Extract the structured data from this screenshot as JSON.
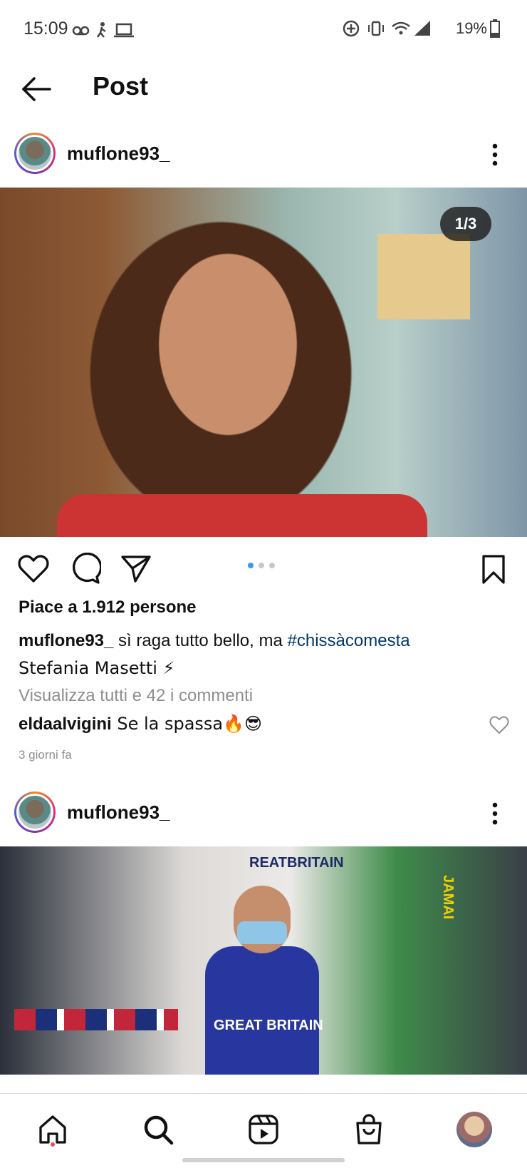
{
  "status_bar": {
    "time": "15:09",
    "battery": "19%"
  },
  "header": {
    "title": "Post"
  },
  "posts": [
    {
      "username": "muflone93_",
      "image_counter": "1/3",
      "carousel_page": 1,
      "carousel_total": 3,
      "likes": "Piace a 1.912 persone",
      "caption_user": "muflone93_",
      "caption_text": " sì raga tutto bello, ma ",
      "caption_hashtag": "#chissàcomesta",
      "caption_line2": "Stefania Masetti ⚡",
      "view_comments": "Visualizza tutti e 42 i commenti",
      "top_comment_user": "eldaalvigini",
      "top_comment_text": " Se la spassa🔥😎",
      "time_ago": "3 giorni fa"
    },
    {
      "username": "muflone93_",
      "image_texts": {
        "shirt": "GREAT BRITAIN",
        "top": "REATBRITAIN",
        "side": "JAMAI"
      }
    }
  ],
  "icons": {
    "back": "arrow-left-icon",
    "more": "more-vertical-icon",
    "like": "heart-icon",
    "comment": "comment-icon",
    "share": "send-icon",
    "save": "bookmark-icon",
    "home": "home-icon",
    "search": "search-icon",
    "reels": "reels-icon",
    "shop": "shop-icon"
  },
  "colors": {
    "hashtag": "#00376b",
    "carousel_active": "#3897f0",
    "notification_dot": "#ed4956",
    "muted_text": "#8e8e8e"
  }
}
